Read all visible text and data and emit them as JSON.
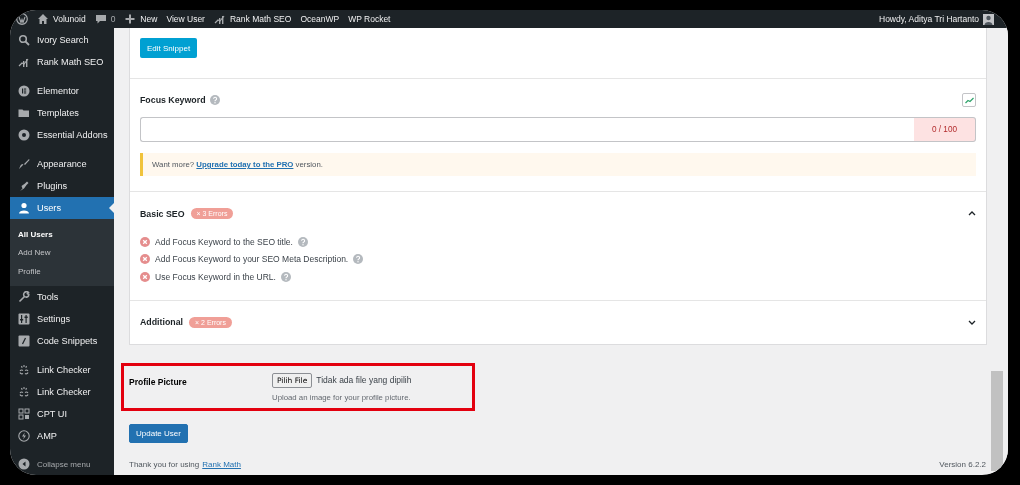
{
  "admin_bar": {
    "items": [
      {
        "kind": "logo"
      },
      {
        "kind": "home",
        "label": "Volunoid"
      },
      {
        "kind": "comments",
        "label": "0"
      },
      {
        "kind": "new",
        "label": "New"
      },
      {
        "kind": "plain",
        "label": "View User"
      },
      {
        "kind": "rankmath",
        "label": "Rank Math SEO"
      },
      {
        "kind": "plain",
        "label": "OceanWP"
      },
      {
        "kind": "plain",
        "label": "WP Rocket"
      }
    ],
    "account": "Howdy, Aditya Tri Hartanto"
  },
  "sidebar": {
    "groups": [
      {
        "items": [
          {
            "label": "Ivory Search",
            "selected": false
          },
          {
            "label": "Rank Math SEO",
            "selected": false
          }
        ]
      },
      {
        "items": [
          {
            "label": "Elementor",
            "selected": false
          },
          {
            "label": "Templates",
            "selected": false
          },
          {
            "label": "Essential Addons",
            "selected": false
          }
        ]
      },
      {
        "items": [
          {
            "label": "Appearance",
            "selected": false
          },
          {
            "label": "Plugins",
            "selected": false
          },
          {
            "label": "Users",
            "selected": true,
            "children": [
              {
                "label": "All Users",
                "selected": true
              },
              {
                "label": "Add New",
                "selected": false
              },
              {
                "label": "Profile",
                "selected": false
              }
            ]
          },
          {
            "label": "Tools",
            "selected": false
          },
          {
            "label": "Settings",
            "selected": false
          },
          {
            "label": "Code Snippets",
            "selected": false
          }
        ]
      },
      {
        "items": [
          {
            "label": "Link Checker",
            "selected": false
          },
          {
            "label": "Link Checker",
            "selected": false
          },
          {
            "label": "CPT UI",
            "selected": false
          },
          {
            "label": "AMP",
            "selected": false
          }
        ]
      }
    ],
    "collapse": "Collapse menu"
  },
  "seo_panel": {
    "edit_button": "Edit Snippet",
    "focus_keyword": {
      "label": "Focus Keyword",
      "counter": "0 / 100",
      "notice_prefix": "Want more?",
      "notice_link": "Upgrade today to the PRO",
      "notice_suffix": "version."
    },
    "sections": [
      {
        "title": "Basic SEO",
        "badge": "× 3 Errors",
        "expanded": true,
        "items": [
          "Add Focus Keyword to the SEO title.",
          "Add Focus Keyword to your SEO Meta Description.",
          "Use Focus Keyword in the URL."
        ]
      },
      {
        "title": "Additional",
        "badge": "× 2 Errors",
        "expanded": false
      }
    ]
  },
  "profile_picture": {
    "label": "Profile Picture",
    "highlighted": true,
    "button": "Pilih File",
    "status": "Tidak ada file yang dipilih",
    "description": "Upload an image for your profile picture."
  },
  "update_button": "Update User",
  "footer": {
    "prefix": "Thank you for using",
    "link": "Rank Math",
    "version": "Version 6.2.2"
  }
}
